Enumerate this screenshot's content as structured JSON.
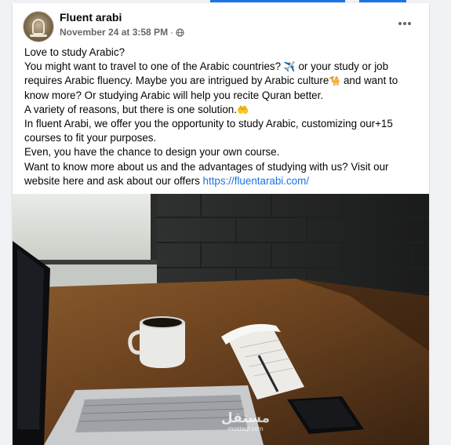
{
  "post": {
    "page_name": "Fluent arabi",
    "timestamp": "November 24 at 3:58 PM",
    "separator": "·",
    "audience_icon": "globe-icon",
    "more_icon": "more-options-icon",
    "lines": [
      {
        "text": "Love to study Arabic?"
      },
      {
        "text": "You might want to travel to one of the Arabic countries? ",
        "emoji": "✈️",
        "after": " or your study or job"
      },
      {
        "text": "requires Arabic fluency. Maybe you are intrigued by Arabic culture",
        "emoji": "🐪",
        "after": " and want to"
      },
      {
        "text": "know more?  Or studying Arabic will help you recite Quran better."
      },
      {
        "text": "A variety of reasons, but there is one solution.",
        "emoji": "🤲"
      },
      {
        "text": "In fluent Arabi, we offer you the opportunity to study Arabic, customizing our+15"
      },
      {
        "text": "courses to fit your purposes."
      },
      {
        "text": "Even, you have the chance to design your own course."
      },
      {
        "text": "Want to know more about us and the advantages of studying with us? Visit our"
      },
      {
        "text": "website here and ask about our offers  ",
        "link": "https://fluentarabi.com/"
      }
    ],
    "image": {
      "description_icon": "desk-photo",
      "watermark_ar": "مستقل",
      "watermark_en": "mostaql.com"
    }
  },
  "colors": {
    "accent": "#1b74e4",
    "text": "#050505",
    "meta": "#65676b",
    "background": "#f0f2f5"
  }
}
